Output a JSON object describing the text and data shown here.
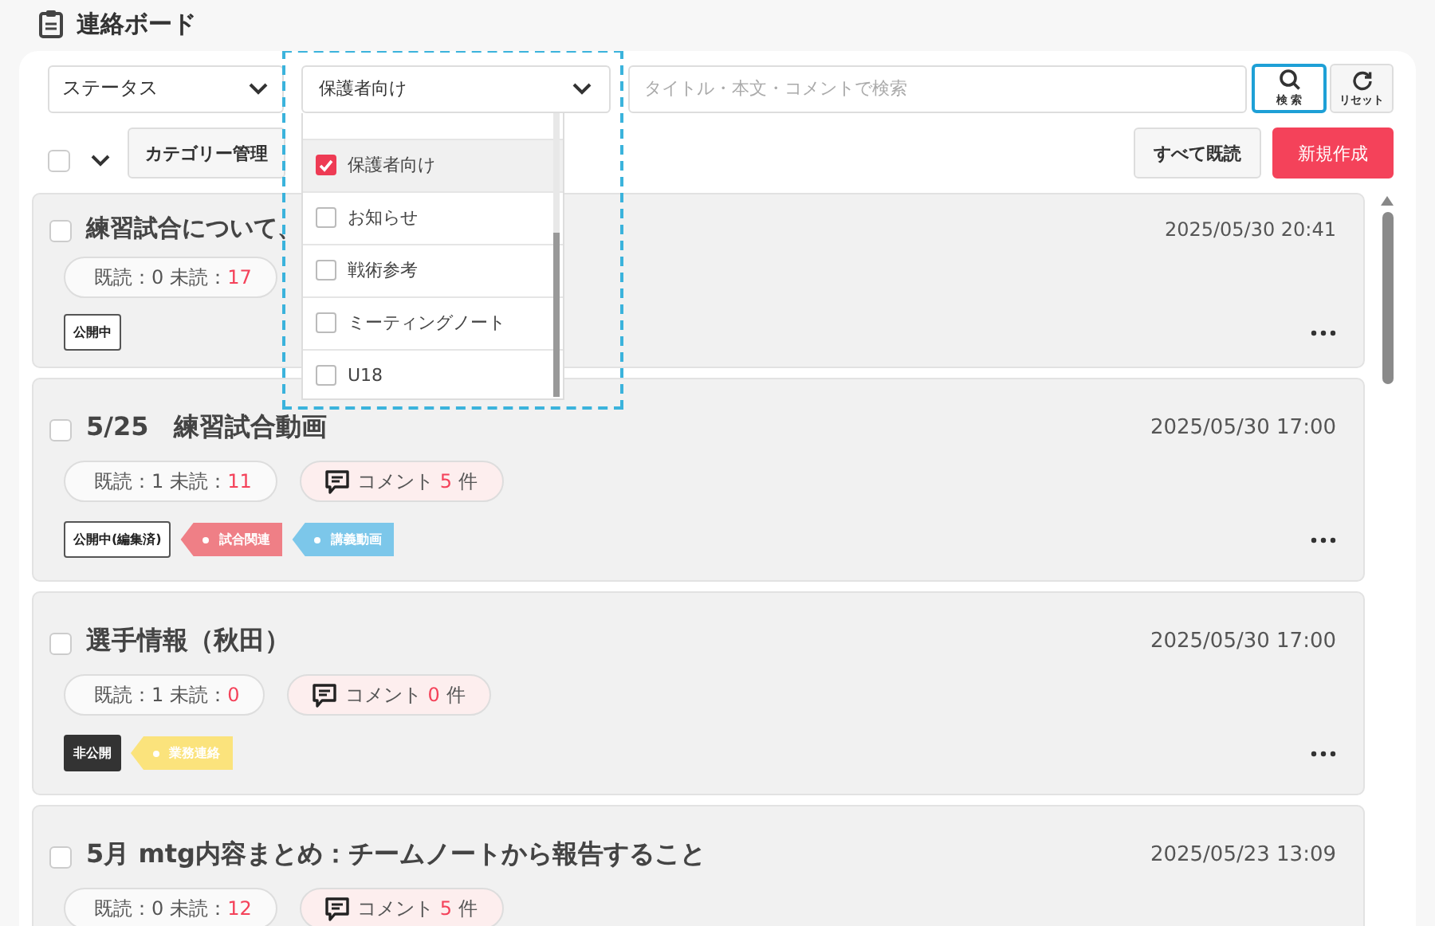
{
  "header": {
    "title": "連絡ボード"
  },
  "filters": {
    "status_select": {
      "value": "ステータス"
    },
    "category_select": {
      "value": "保護者向け",
      "expanded": true,
      "highlighted": true,
      "options": [
        {
          "label": "保護者向け",
          "checked": true
        },
        {
          "label": "お知らせ",
          "checked": false
        },
        {
          "label": "戦術参考",
          "checked": false
        },
        {
          "label": "ミーティングノート",
          "checked": false
        },
        {
          "label": "U18",
          "checked": false
        }
      ]
    },
    "search": {
      "placeholder": "タイトル・本文・コメントで検索"
    },
    "search_button": {
      "label": "検 索",
      "highlighted": true
    },
    "reset_button": {
      "label": "リセット"
    }
  },
  "toolbar": {
    "select_all_checked": false,
    "category_button": "カテゴリー管理",
    "mark_all_read_button": "すべて既読",
    "new_post_button": "新規作成"
  },
  "posts": [
    {
      "title": "練習試合について、",
      "checked": false,
      "date": "2025/05/30 20:41",
      "read": "既読：0",
      "unread_label": "未読：",
      "unread": "17",
      "status": {
        "label": "公開中",
        "kind": "outline"
      }
    },
    {
      "title": "5/25　練習試合動画",
      "checked": false,
      "date": "2025/05/30 17:00",
      "read": "既読：1",
      "unread_label": "未読：",
      "unread": "11",
      "comment": {
        "label": "コメント",
        "count": "5",
        "unit": "件"
      },
      "status": {
        "label": "公開中(編集済)",
        "kind": "outline"
      },
      "tags": [
        {
          "label": "試合関連",
          "color": "#ef7f86"
        },
        {
          "label": "講義動画",
          "color": "#7cc7ea"
        }
      ]
    },
    {
      "title": "選手情報（秋田）",
      "checked": false,
      "date": "2025/05/30 17:00",
      "read": "既読：1",
      "unread_label": "未読：",
      "unread": "0",
      "comment": {
        "label": "コメント",
        "count": "0",
        "unit": "件"
      },
      "status": {
        "label": "非公開",
        "kind": "dark"
      },
      "tags": [
        {
          "label": "業務連絡",
          "color": "#fbe37c"
        }
      ]
    },
    {
      "title": "5月 mtg内容まとめ：チームノートから報告すること",
      "checked": false,
      "date": "2025/05/23 13:09",
      "read": "既読：0",
      "unread_label": "未読：",
      "unread": "12",
      "comment": {
        "label": "コメント",
        "count": "5",
        "unit": "件"
      }
    }
  ]
}
